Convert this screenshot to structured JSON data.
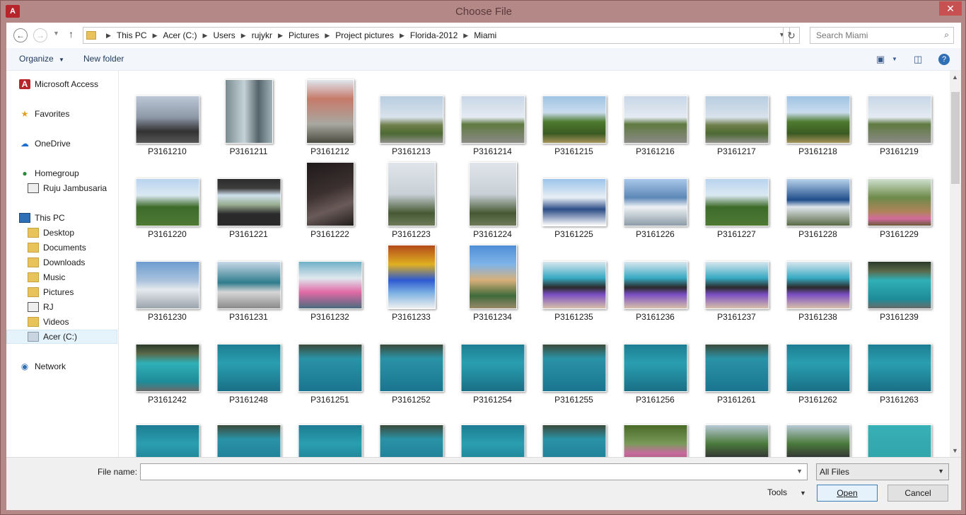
{
  "window": {
    "title": "Choose File",
    "app_icon": "A"
  },
  "address": {
    "crumbs": [
      "This PC",
      "Acer (C:)",
      "Users",
      "rujykr",
      "Pictures",
      "Project pictures",
      "Florida-2012",
      "Miami"
    ],
    "search_placeholder": "Search Miami"
  },
  "toolbar": {
    "organize": "Organize",
    "new_folder": "New folder"
  },
  "nav": {
    "microsoft_access": "Microsoft Access",
    "favorites": "Favorites",
    "onedrive": "OneDrive",
    "homegroup": "Homegroup",
    "homegroup_user": "Ruju Jambusaria",
    "this_pc": "This PC",
    "desktop": "Desktop",
    "documents": "Documents",
    "downloads": "Downloads",
    "music": "Music",
    "pictures": "Pictures",
    "rj": "RJ",
    "videos": "Videos",
    "drive_c": "Acer (C:)",
    "network": "Network"
  },
  "files": [
    "P3161210",
    "P3161211",
    "P3161212",
    "P3161213",
    "P3161214",
    "P3161215",
    "P3161216",
    "P3161217",
    "P3161218",
    "P3161219",
    "P3161220",
    "P3161221",
    "P3161222",
    "P3161223",
    "P3161224",
    "P3161225",
    "P3161226",
    "P3161227",
    "P3161228",
    "P3161229",
    "P3161230",
    "P3161231",
    "P3161232",
    "P3161233",
    "P3161234",
    "P3161235",
    "P3161236",
    "P3161237",
    "P3161238",
    "P3161239",
    "P3161242",
    "P3161248",
    "P3161251",
    "P3161252",
    "P3161254",
    "P3161255",
    "P3161256",
    "P3161261",
    "P3161262",
    "P3161263"
  ],
  "bottom": {
    "file_name_label": "File name:",
    "file_name_value": "",
    "filter": "All Files",
    "tools": "Tools",
    "open": "Open",
    "cancel": "Cancel"
  }
}
